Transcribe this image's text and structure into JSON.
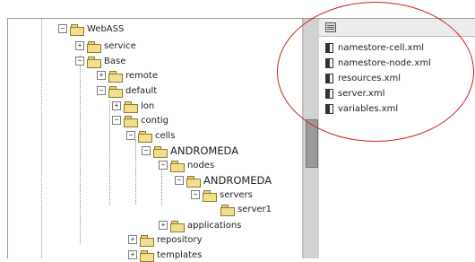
{
  "tree": {
    "items": [
      {
        "label": "WebASS",
        "expanded": true,
        "large": false
      },
      {
        "label": "service",
        "expanded": false,
        "large": false
      },
      {
        "label": "Base",
        "expanded": true,
        "large": false
      },
      {
        "label": "remote",
        "expanded": false,
        "large": false
      },
      {
        "label": "default",
        "expanded": true,
        "large": false
      },
      {
        "label": "lon",
        "expanded": false,
        "large": false
      },
      {
        "label": "contig",
        "expanded": true,
        "large": false
      },
      {
        "label": "cells",
        "expanded": true,
        "large": false
      },
      {
        "label": "ANDROMEDA",
        "expanded": true,
        "large": true
      },
      {
        "label": "nodes",
        "expanded": true,
        "large": false
      },
      {
        "label": "ANDROMEDA",
        "expanded": true,
        "large": true
      },
      {
        "label": "servers",
        "expanded": true,
        "large": false
      },
      {
        "label": "server1",
        "expanded": null,
        "large": false
      },
      {
        "label": "applications",
        "expanded": false,
        "large": false
      },
      {
        "label": "repository",
        "expanded": false,
        "large": false
      },
      {
        "label": "templates",
        "expanded": false,
        "large": false
      }
    ]
  },
  "files": {
    "header": "",
    "items": [
      "namestore-cell.xml",
      "namestore-node.xml",
      "resources.xml",
      "server.xml",
      "variables.xml"
    ]
  },
  "colors": {
    "annotation": "#d61f1f",
    "folder": "#f2df8d"
  }
}
